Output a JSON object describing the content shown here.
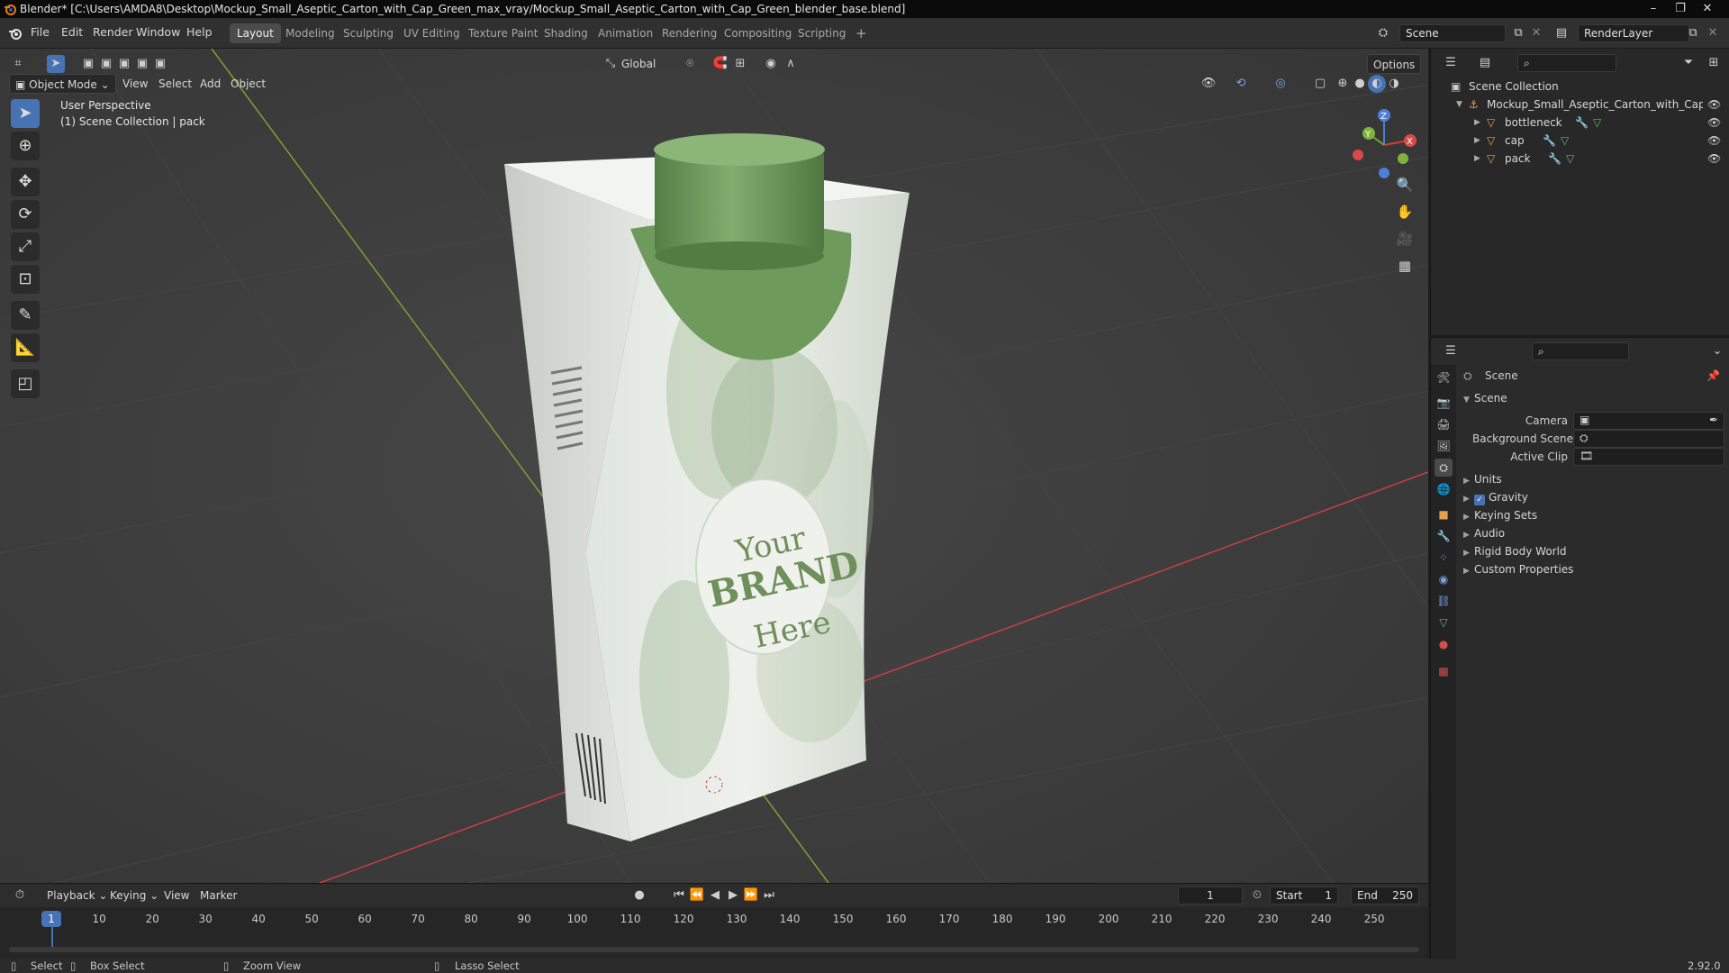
{
  "titlebar": {
    "title": "Blender* [C:\\Users\\AMDA8\\Desktop\\Mockup_Small_Aseptic_Carton_with_Cap_Green_max_vray/Mockup_Small_Aseptic_Carton_with_Cap_Green_blender_base.blend]",
    "minimize": "–",
    "maximize": "❐",
    "close": "✕"
  },
  "menu": {
    "file": "File",
    "edit": "Edit",
    "render": "Render",
    "window": "Window",
    "help": "Help"
  },
  "workspaces": [
    "Layout",
    "Modeling",
    "Sculpting",
    "UV Editing",
    "Texture Paint",
    "Shading",
    "Animation",
    "Rendering",
    "Compositing",
    "Scripting"
  ],
  "workspace_add": "+",
  "scene_field": "Scene",
  "renderlayer_field": "RenderLayer",
  "viewport": {
    "transform_orientation": "Global",
    "options": "Options",
    "mode": "Object Mode",
    "menu_view": "View",
    "menu_select": "Select",
    "menu_add": "Add",
    "menu_object": "Object",
    "info_line1": "User Perspective",
    "info_line2": "(1) Scene Collection | pack",
    "brand_your": "Your",
    "brand_brand": "BRAND",
    "brand_here": "Here",
    "gizmo_z": "Z",
    "gizmo_y": "Y",
    "gizmo_x": "X"
  },
  "timeline": {
    "playback": "Playback",
    "keying": "Keying",
    "view": "View",
    "marker": "Marker",
    "current_frame": "1",
    "start_label": "Start",
    "start_value": "1",
    "end_label": "End",
    "end_value": "250",
    "ruler": [
      "10",
      "20",
      "30",
      "40",
      "50",
      "60",
      "70",
      "80",
      "90",
      "100",
      "110",
      "120",
      "130",
      "140",
      "150",
      "160",
      "170",
      "180",
      "190",
      "200",
      "210",
      "220",
      "230",
      "240",
      "250"
    ],
    "playhead": "1"
  },
  "statusbar": {
    "select": "Select",
    "box_select": "Box Select",
    "zoom_view": "Zoom View",
    "lasso_select": "Lasso Select",
    "version": "2.92.0"
  },
  "outliner": {
    "root": "Scene Collection",
    "collection": "Mockup_Small_Aseptic_Carton_with_Cap_Gr",
    "objects": [
      "bottleneck",
      "cap",
      "pack"
    ]
  },
  "properties": {
    "context": "Scene",
    "panel_scene": "Scene",
    "camera_label": "Camera",
    "background_scene_label": "Background Scene",
    "active_clip_label": "Active Clip",
    "panels": [
      "Units",
      "Gravity",
      "Keying Sets",
      "Audio",
      "Rigid Body World",
      "Custom Properties"
    ],
    "gravity_enabled": true
  },
  "colors": {
    "accent": "#4772b3",
    "viewport_bg": "#3c3c3c",
    "axis_x": "#c8413c",
    "axis_y": "#7aa233",
    "cap_green": "#6e9a5c"
  }
}
